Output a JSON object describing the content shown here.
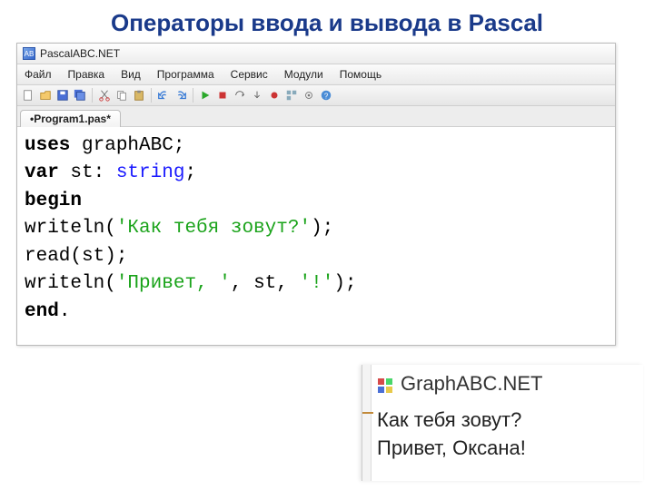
{
  "slide": {
    "title": "Операторы ввода и вывода в Pascal"
  },
  "ide": {
    "app_title": "PascalABC.NET",
    "menu": [
      "Файл",
      "Правка",
      "Вид",
      "Программа",
      "Сервис",
      "Модули",
      "Помощь"
    ],
    "toolbar_icons": [
      "new",
      "open",
      "save",
      "saveall",
      "cut",
      "copy",
      "paste",
      "undo",
      "redo",
      "run",
      "stop",
      "stepover",
      "stepinto",
      "break",
      "modules",
      "options",
      "help"
    ],
    "tab": "•Program1.pas*",
    "code": {
      "l1_uses": "uses",
      "l1_mod": " graphABC",
      "l1_semi": ";",
      "l2_var": "var",
      "l2_decl": " st: ",
      "l2_type": "string",
      "l2_semi": ";",
      "l3_begin": "begin",
      "l4_call": "writeln(",
      "l4_str": "'Как тебя зовут?'",
      "l4_end": ");",
      "l5_call": "read(",
      "l5_arg": "st",
      "l5_end": ");",
      "l6_call": "writeln(",
      "l6_s1": "'Привет, '",
      "l6_c1": ", ",
      "l6_var": "st",
      "l6_c2": ", ",
      "l6_s2": "'!'",
      "l6_end": ");",
      "l7_end": "end",
      "l7_dot": "."
    }
  },
  "output": {
    "window_title": "GraphABC.NET",
    "lines": [
      "Как тебя зовут?",
      "Привет, Оксана!"
    ]
  }
}
